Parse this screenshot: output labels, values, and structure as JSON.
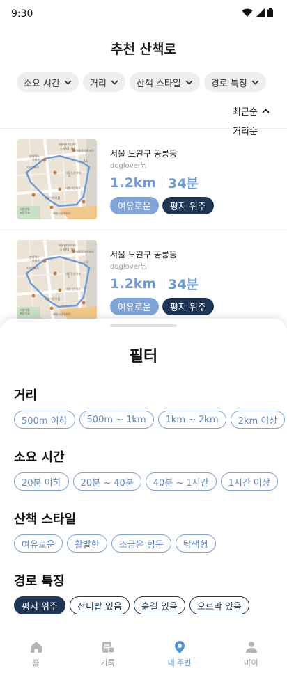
{
  "status": {
    "time": "9:30"
  },
  "header": {
    "title": "추천 산책로"
  },
  "filter_chips": [
    {
      "label": "소요 시간"
    },
    {
      "label": "거리"
    },
    {
      "label": "산책 스타일"
    },
    {
      "label": "경로 특징"
    }
  ],
  "sort": {
    "options": [
      "최근순",
      "거리순"
    ],
    "selected": "최근순"
  },
  "routes": [
    {
      "location": "서울 노원구 공릉동",
      "user": "doglover님",
      "distance": "1.2km",
      "duration": "34분",
      "tags": [
        "여유로운",
        "평지 위주"
      ],
      "map_labels": [
        "태릉현대아파트",
        "스위트1단지",
        "태릉동성해피아",
        "CU",
        "현대맥스",
        "아파트",
        "기리아파트",
        "태릉풍한아파",
        "트",
        "대형가전마트",
        "태릉어린이집",
        "서울태릉",
        "초등학교",
        "태릉시영아파트"
      ]
    },
    {
      "location": "서울 노원구 공릉동",
      "user": "doglover님",
      "distance": "1.2km",
      "duration": "34분",
      "tags": [
        "여유로운",
        "평지 위주"
      ],
      "map_labels": [
        "태릉현대아파트",
        "스위트1단지",
        "태릉동성해피아",
        "CU",
        "현대맥스",
        "아파트",
        "기리아파트",
        "태릉풍한아파",
        "트",
        "대형가전마트",
        "태릉어린이집",
        "서울태릉",
        "초등학교",
        "태릉시영아파트"
      ]
    }
  ],
  "sheet": {
    "title": "필터",
    "sections": [
      {
        "title": "거리",
        "options": [
          "500m 이하",
          "500m ~ 1km",
          "1km ~ 2km",
          "2km 이상"
        ]
      },
      {
        "title": "소요 시간",
        "options": [
          "20분 이하",
          "20분 ~ 40분",
          "40분 ~ 1시간",
          "1시간 이상"
        ]
      },
      {
        "title": "산책 스타일",
        "options": [
          "여유로운",
          "활발한",
          "조금은 힘든",
          "탐색형"
        ]
      },
      {
        "title": "경로 특징",
        "options": [
          "평지 위주",
          "잔디밭 있음",
          "흙길 있음",
          "오르막 있음"
        ],
        "selected": "평지 위주"
      }
    ]
  },
  "nav": {
    "items": [
      {
        "label": "홈",
        "icon": "home-icon"
      },
      {
        "label": "기록",
        "icon": "record-icon"
      },
      {
        "label": "내 주변",
        "icon": "location-pin-icon",
        "active": true
      },
      {
        "label": "마이",
        "icon": "person-icon"
      }
    ]
  },
  "colors": {
    "accent": "#4a90d9",
    "primary_dark": "#1e3556",
    "light_blue": "#7ea4d8"
  }
}
